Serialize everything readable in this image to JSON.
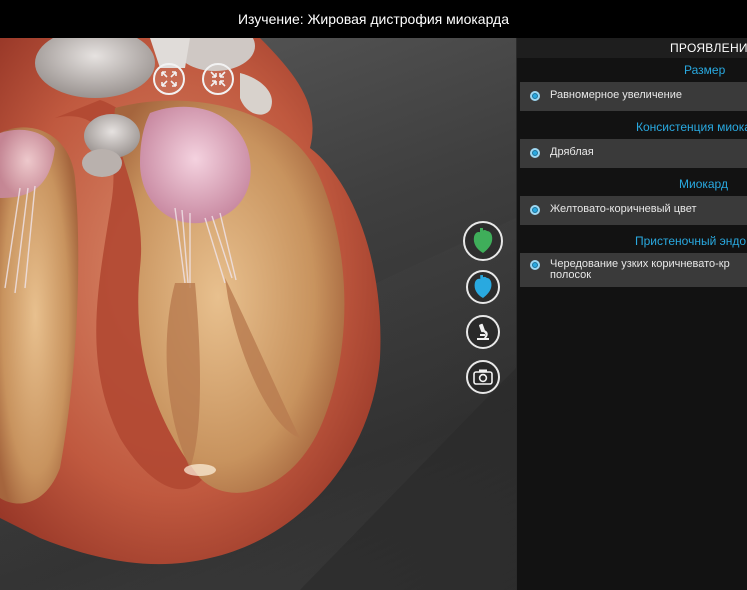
{
  "window": {
    "title": "Изучение: Жировая дистрофия миокарда"
  },
  "viewport": {
    "view_buttons": [
      {
        "name": "expand-view-button",
        "icon": "expand-arrows-icon"
      },
      {
        "name": "collapse-view-button",
        "icon": "collapse-arrows-icon"
      }
    ],
    "tools": [
      {
        "name": "heart-model-green-button",
        "icon": "heart-green-icon",
        "color": "#3fae5a",
        "active": true
      },
      {
        "name": "heart-model-blue-button",
        "icon": "heart-blue-icon",
        "color": "#29a9e0",
        "active": false
      },
      {
        "name": "microscope-button",
        "icon": "microscope-icon",
        "active": false
      },
      {
        "name": "camera-button",
        "icon": "camera-icon",
        "active": false
      }
    ]
  },
  "panel": {
    "header": "ПРОЯВЛЕНИЯ",
    "sections": [
      {
        "title": "Размер",
        "items": [
          "Равномерное увеличение"
        ]
      },
      {
        "title": "Консистенция миока",
        "items": [
          "Дряблая"
        ]
      },
      {
        "title": "Миокард",
        "items": [
          "Желтовато-коричневый цвет"
        ]
      },
      {
        "title": "Пристеночный эндо",
        "items": [
          "Чередование узких коричневато-кр\nполосок"
        ]
      }
    ]
  },
  "colors": {
    "accent": "#29a9e0",
    "panel_bg": "#121212",
    "item_bg": "#3a3a3a"
  }
}
